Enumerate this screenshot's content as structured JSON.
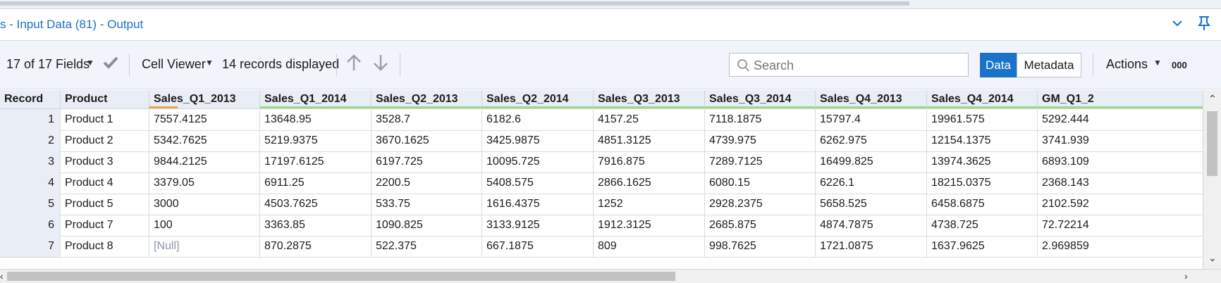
{
  "window": {
    "title": "s - Input Data (81) - Output"
  },
  "toolbar": {
    "fields_label": "17 of 17 Fields",
    "cell_viewer_label": "Cell Viewer",
    "records_label": "14 records displayed",
    "search_placeholder": "Search",
    "data_button": "Data",
    "metadata_button": "Metadata",
    "actions_label": "Actions",
    "actions_extra": "000"
  },
  "icons": {
    "fields_dropdown": "caret-down-icon",
    "apply": "checkmark-icon",
    "up": "arrow-up-icon",
    "down": "arrow-down-icon",
    "search": "search-icon",
    "collapse": "chevron-down-icon",
    "pin": "pin-icon"
  },
  "colors": {
    "accent": "#1a73c7",
    "header_bg": "#e9edf5",
    "toolbar_bg": "#f1f4fa",
    "null_text": "#8a99ad",
    "column_underline": "#9bdc86",
    "column_underline_alt": "#f2a545"
  },
  "table": {
    "columns": [
      "Record",
      "Product",
      "Sales_Q1_2013",
      "Sales_Q1_2014",
      "Sales_Q2_2013",
      "Sales_Q2_2014",
      "Sales_Q3_2013",
      "Sales_Q3_2014",
      "Sales_Q4_2013",
      "Sales_Q4_2014",
      "GM_Q1_2"
    ],
    "rows": [
      [
        "1",
        "Product 1",
        "7557.4125",
        "13648.95",
        "3528.7",
        "6182.6",
        "4157.25",
        "7118.1875",
        "15797.4",
        "19961.575",
        "5292.444"
      ],
      [
        "2",
        "Product 2",
        "5342.7625",
        "5219.9375",
        "3670.1625",
        "3425.9875",
        "4851.3125",
        "4739.975",
        "6262.975",
        "12154.1375",
        "3741.939"
      ],
      [
        "3",
        "Product 3",
        "9844.2125",
        "17197.6125",
        "6197.725",
        "10095.725",
        "7916.875",
        "7289.7125",
        "16499.825",
        "13974.3625",
        "6893.109"
      ],
      [
        "4",
        "Product 4",
        "3379.05",
        "6911.25",
        "2200.5",
        "5408.575",
        "2866.1625",
        "6080.15",
        "6226.1",
        "18215.0375",
        "2368.143"
      ],
      [
        "5",
        "Product 5",
        "3000",
        "4503.7625",
        "533.75",
        "1616.4375",
        "1252",
        "2928.2375",
        "5658.525",
        "6458.6875",
        "2102.592"
      ],
      [
        "6",
        "Product 7",
        "100",
        "3363.85",
        "1090.825",
        "3133.9125",
        "1912.3125",
        "2685.875",
        "4874.7875",
        "4738.725",
        "72.72214"
      ],
      [
        "7",
        "Product 8",
        "[Null]",
        "870.2875",
        "522.375",
        "667.1875",
        "809",
        "998.7625",
        "1721.0875",
        "1637.9625",
        "2.969859"
      ]
    ]
  }
}
